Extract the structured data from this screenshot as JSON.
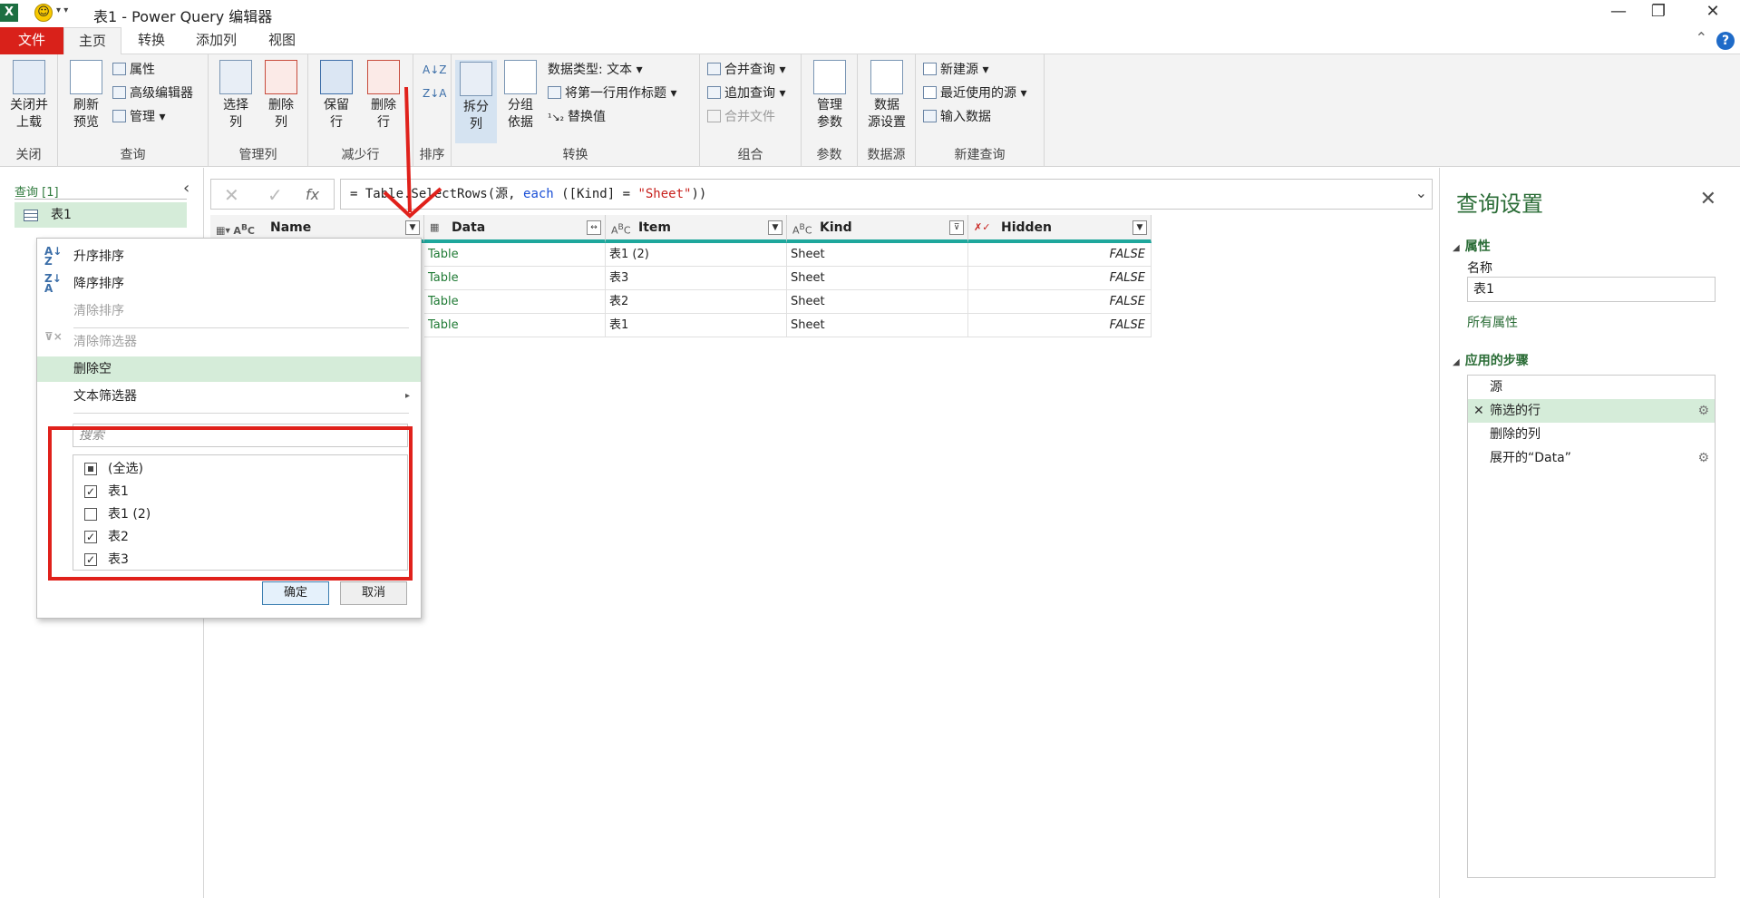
{
  "titlebar": {
    "title": "表1 - Power Query 编辑器",
    "excel_badge": "X",
    "minimize": "—",
    "restore": "❐",
    "close": "✕"
  },
  "tabs": {
    "file": "文件",
    "home": "主页",
    "transform": "转换",
    "add_column": "添加列",
    "view": "视图"
  },
  "ribbon": {
    "close_load": "关闭并\n上载",
    "close_group": "关闭",
    "refresh_preview": "刷新\n预览",
    "properties": "属性",
    "advanced_editor": "高级编辑器",
    "manage": "管理",
    "query_group": "查询",
    "choose_columns": "选择\n列",
    "remove_columns": "删除\n列",
    "manage_columns_group": "管理列",
    "keep_rows": "保留\n行",
    "remove_rows": "删除\n行",
    "reduce_rows_group": "减少行",
    "sort_group": "排序",
    "split_column": "拆分\n列",
    "group_by": "分组\n依据",
    "data_type": "数据类型: 文本",
    "use_first_row": "将第一行用作标题",
    "replace_values": "替换值",
    "transform_group": "转换",
    "merge_queries": "合并查询",
    "append_queries": "追加查询",
    "combine_files": "合并文件",
    "combine_group": "组合",
    "manage_params": "管理\n参数",
    "params_group": "参数",
    "datasource_settings": "数据\n源设置",
    "datasource_group": "数据源",
    "new_source": "新建源",
    "recent_sources": "最近使用的源",
    "enter_data": "输入数据",
    "new_query_group": "新建查询"
  },
  "queries": {
    "header": "查询 [1]",
    "items": [
      "表1"
    ]
  },
  "formula": {
    "prefix": "= Table.SelectRows(源, ",
    "kw": "each",
    "mid": " ([Kind] = ",
    "str": "\"Sheet\"",
    "end": "))",
    "fx": "fx"
  },
  "grid": {
    "columns": [
      {
        "type": "ABC",
        "name": "Name"
      },
      {
        "type": "",
        "name": "Data"
      },
      {
        "type": "ABC",
        "name": "Item"
      },
      {
        "type": "ABC",
        "name": "Kind"
      },
      {
        "type": "",
        "name": "Hidden"
      }
    ],
    "rows": [
      {
        "data": "Table",
        "item": "表1 (2)",
        "kind": "Sheet",
        "hidden": "FALSE"
      },
      {
        "data": "Table",
        "item": "表3",
        "kind": "Sheet",
        "hidden": "FALSE"
      },
      {
        "data": "Table",
        "item": "表2",
        "kind": "Sheet",
        "hidden": "FALSE"
      },
      {
        "data": "Table",
        "item": "表1",
        "kind": "Sheet",
        "hidden": "FALSE"
      }
    ]
  },
  "filter": {
    "sort_asc": "升序排序",
    "sort_desc": "降序排序",
    "clear_sort": "清除排序",
    "clear_filter": "清除筛选器",
    "remove_empty": "删除空",
    "text_filters": "文本筛选器",
    "search_placeholder": "搜索",
    "options": [
      {
        "label": "(全选)",
        "state": "partial"
      },
      {
        "label": "表1",
        "state": "checked"
      },
      {
        "label": "表1 (2)",
        "state": "unchecked"
      },
      {
        "label": "表2",
        "state": "checked"
      },
      {
        "label": "表3",
        "state": "checked"
      }
    ],
    "ok": "确定",
    "cancel": "取消"
  },
  "settings": {
    "title": "查询设置",
    "properties": "属性",
    "name_label": "名称",
    "name_value": "表1",
    "all_properties": "所有属性",
    "applied_steps": "应用的步骤",
    "steps": [
      "源",
      "筛选的行",
      "删除的列",
      "展开的“Data”"
    ]
  },
  "colors": {
    "accent": "#2a6c36",
    "annotation_red": "#e0211b",
    "selection": "#d5ecd9",
    "header_underline": "#1ea79c"
  }
}
